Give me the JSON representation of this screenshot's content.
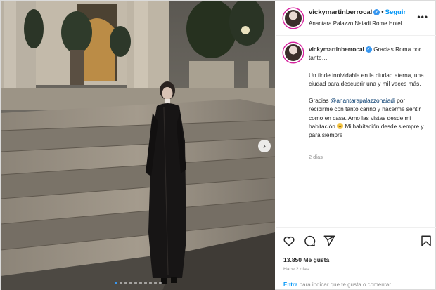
{
  "post": {
    "username": "vickymartinberrocal",
    "follow_label": "Seguir",
    "location": "Anantara Palazzo Naiadi Rome Hotel",
    "more_label": "•••",
    "caption": {
      "first_line": "Gracias Roma por tanto…",
      "paragraph_2": "Un finde inolvidable en la ciudad eterna, una ciudad para descubrir una y mil veces más.",
      "p3_prefix": "Gracias ",
      "mention": "@anantarapalazzonaiadi",
      "p3_middle": " por recibirme con tanto cariño y hacerme sentir como en casa. Amo las vistas desde mi habitación ",
      "p3_suffix": " Mi habitación desde siempre y para siempre",
      "time": "2 días"
    },
    "likes": "13.850 Me gusta",
    "posted_ago": "Hace 2 días",
    "comment_prompt": {
      "enter": "Entra",
      "rest": " para indicar que te gusta o comentar."
    },
    "carousel": {
      "total": 10,
      "active": 0
    },
    "next_label": "›"
  },
  "icons": [
    "heart-icon",
    "comment-icon",
    "share-icon",
    "bookmark-icon",
    "more-options-icon",
    "verified-badge-icon",
    "chevron-right-icon"
  ],
  "colors": {
    "accent": "#0095f6",
    "verified": "#3897f0",
    "mention": "#00376b",
    "muted": "#8e8e8e"
  }
}
